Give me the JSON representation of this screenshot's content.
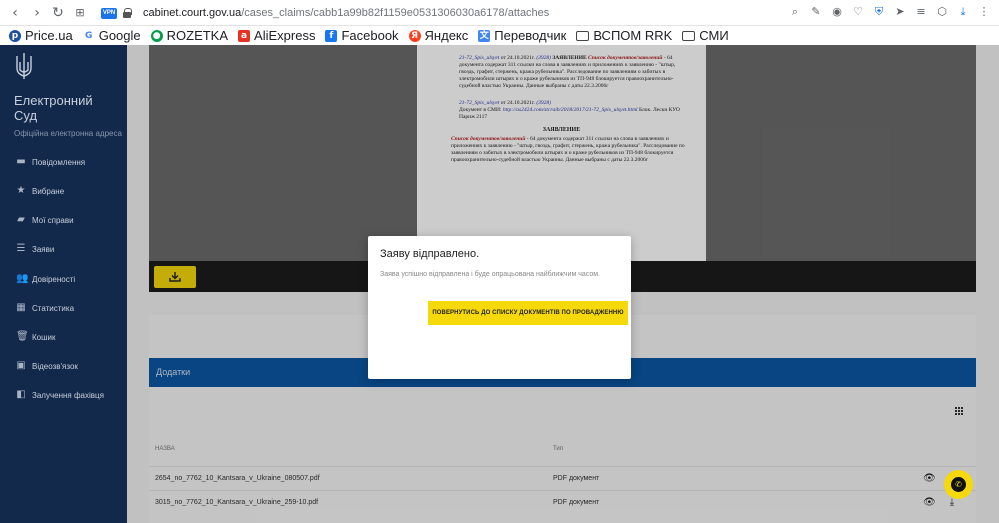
{
  "browser": {
    "url_host": "cabinet.court.gov.ua",
    "url_path": "/cases_claims/cabb1a99b82f1159e0531306030a6178/attaches",
    "vpn_label": "VPN"
  },
  "bookmarks": [
    {
      "label": "Price.ua",
      "icon": "price-icon",
      "color": "#1d4ea0"
    },
    {
      "label": "Google",
      "icon": "google-icon",
      "color": "#4285f4"
    },
    {
      "label": "ROZETKA",
      "icon": "rozetka-icon",
      "color": "#00a046"
    },
    {
      "label": "AliExpress",
      "icon": "aliexpress-icon",
      "color": "#e43225"
    },
    {
      "label": "Facebook",
      "icon": "facebook-icon",
      "color": "#1877f2"
    },
    {
      "label": "Яндекс",
      "icon": "yandex-icon",
      "color": "#fc3f1d"
    },
    {
      "label": "Переводчик",
      "icon": "translate-icon",
      "color": "#4285f4"
    },
    {
      "label": "ВСПОМ RRK",
      "icon": "folder-icon",
      "color": "#ffffff"
    },
    {
      "label": "СМИ",
      "icon": "folder-icon",
      "color": "#ffffff"
    }
  ],
  "sidebar": {
    "brand_line1": "Електронний",
    "brand_line2": "Суд",
    "brand_sub": "Офіційна електронна адреса",
    "items": [
      {
        "label": "Повідомлення",
        "icon": "message-icon"
      },
      {
        "label": "Вибране",
        "icon": "star-icon"
      },
      {
        "label": "Мої справи",
        "icon": "folder-icon"
      },
      {
        "label": "Заяви",
        "icon": "list-icon"
      },
      {
        "label": "Довіреності",
        "icon": "users-icon"
      },
      {
        "label": "Статистика",
        "icon": "chart-icon"
      },
      {
        "label": "Кошик",
        "icon": "trash-icon"
      },
      {
        "label": "Відеозв'язок",
        "icon": "video-icon"
      },
      {
        "label": "Залучення фахівця",
        "icon": "specialist-icon"
      }
    ]
  },
  "document": {
    "para1_ref": "21-72_Spis_ulsyet",
    "para1_date": "от 24.10.2021г.",
    "para1_num": "(3928)",
    "para1_head": "ЗАЯВЛЕНИЕ",
    "para1_red": "Список документов/заявлений",
    "para1_text": "- 64 документа содержат 311 ссылки на слова в заявлениях и приложениях к заявлению - \"штыр, гвоздь, графит, стержень, кража рубельника\". Расследование по заявлениям о забитых в электромобили штырях и о краже рубельников из ТП-948 блокируется правоохранительно-судебной властью Украины. Данные выбраны с даты 22.3.2006г",
    "para2_ref": "21-72_Spis_ulsyet",
    "para2_date": "от 24.10.2021г.",
    "para2_num": "(3928)",
    "para2_text": "Документ в СМИ:",
    "para2_link": "http://as2424.com/stcraib/2018/2017/21-72_Spis_ulsyet.html",
    "para2_tail": "Блок. Лески КУО Париж 2117",
    "heading": "ЗАЯВЛЕНИЕ",
    "para3_red": "Список документов/заявлений",
    "para3_text": "- 64 документа содержат 311 ссылки на слова в заявлениях и приложениях к заявлению - \"штыр, гвоздь, графит, стержень, кража рубельника\". Расследование по заявлениям о забитых в электромобили штырях и о краже рубельников из ТП-948 блокируется правоохранительно-судебной властью Украины. Данные выбраны с даты 22.3.2006г"
  },
  "attachments": {
    "title": "Додатки",
    "col_name": "НАЗВА",
    "col_type": "Тип",
    "rows": [
      {
        "name": "2654_no_7762_10_Kantsara_v_Ukraine_080507.pdf",
        "type": "PDF документ"
      },
      {
        "name": "3015_no_7762_10_Kantsara_v_Ukraine_259-10.pdf",
        "type": "PDF документ"
      }
    ]
  },
  "modal": {
    "title": "Заяву відправлено.",
    "text": "Заява успішно відправлена і буде опрацьована найближчим часом.",
    "button": "ПОВЕРНУТИСЬ ДО СПИСКУ ДОКУМЕНТІВ ПО ПРОВАДЖЕННЮ"
  },
  "colors": {
    "sidebar_bg": "#13294b",
    "accent_yellow": "#f5d90a",
    "card_header_blue": "#0c57a3"
  }
}
